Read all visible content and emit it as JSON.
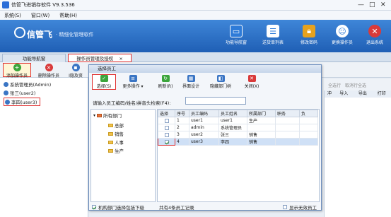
{
  "window": {
    "title": "信管飞进销存软件 V9.3.536",
    "min": "—",
    "max": "□",
    "close": "✕"
  },
  "menu": [
    "系统(S)",
    "窗口(W)",
    "帮助(H)"
  ],
  "brand": {
    "name": "信管飞",
    "subtitle": "· 精细化管理软件"
  },
  "top_buttons": [
    {
      "label": "功能导航窗",
      "icon": "monitor-icon",
      "color": "#2e7bd8"
    },
    {
      "label": "送货单列表",
      "icon": "list-icon",
      "color": "#2e7bd8"
    },
    {
      "label": "修改密码",
      "icon": "lock-icon",
      "color": "#e6a21e"
    },
    {
      "label": "更换操作员",
      "icon": "user-icon",
      "color": "#2e7bd8"
    },
    {
      "label": "退出系统",
      "icon": "exit-icon",
      "color": "#d93a3a"
    }
  ],
  "tabs": [
    {
      "label": "功能导航窗"
    },
    {
      "label": "操作员管理及授权",
      "close": "×"
    }
  ],
  "toolbar": [
    {
      "label": "添加操作员",
      "color": "#3ba53b",
      "glyph": "+"
    },
    {
      "label": "删除操作员",
      "color": "#d93a3a",
      "glyph": "×"
    },
    {
      "label": "Ⅰ隐及资"
    }
  ],
  "operators": [
    "系统管理员(Admin)",
    "张三(user2)",
    "李四(user3)"
  ],
  "right_panel": {
    "select_all": "全选行",
    "cancel_all": "取消行全选",
    "headers": [
      "冲",
      "导入",
      "导出",
      "打印"
    ]
  },
  "dialog": {
    "title": "选择员工",
    "toolbar": [
      {
        "label": "选择(S)",
        "icon": "check-icon",
        "color": "#3ba53b",
        "glyph": "✓"
      },
      {
        "label": "更多操作",
        "icon": "more-icon",
        "color": "#3a75c4",
        "glyph": "≡",
        "dropdown": "▾"
      },
      {
        "label": "刷新(R)",
        "icon": "refresh-icon",
        "color": "#3ba53b",
        "glyph": "↻"
      },
      {
        "label": "界面设计",
        "icon": "design-icon",
        "color": "#3a75c4",
        "glyph": "▦"
      },
      {
        "label": "隐藏部门树",
        "icon": "hide-icon",
        "color": "#3a75c4",
        "glyph": "◧"
      },
      {
        "label": "关闭(X)",
        "icon": "close-icon",
        "color": "#d93a3a",
        "glyph": "✕"
      }
    ],
    "search_label": "请输入员工编码/姓名/拼音头检索(F4):",
    "search_value": "",
    "dept_root": "所有部门",
    "departments": [
      "总部",
      "销售",
      "人事",
      "生产"
    ],
    "columns": [
      "选择",
      "序号",
      "员工编码",
      "员工姓名",
      "所属部门",
      "职务",
      "负"
    ],
    "rows": [
      {
        "no": "1",
        "code": "user1",
        "name": "user1",
        "dept": "生产",
        "checked": false
      },
      {
        "no": "2",
        "code": "admin",
        "name": "系统管理员",
        "dept": "",
        "checked": false
      },
      {
        "no": "3",
        "code": "user2",
        "name": "张三",
        "dept": "销售",
        "checked": false
      },
      {
        "no": "4",
        "code": "user3",
        "name": "李四",
        "dept": "销售",
        "checked": true
      }
    ],
    "include_sub": "机构部门选择包括下级",
    "record_count": "共有4条员工记录",
    "show_invalid": "显示无效员工"
  }
}
